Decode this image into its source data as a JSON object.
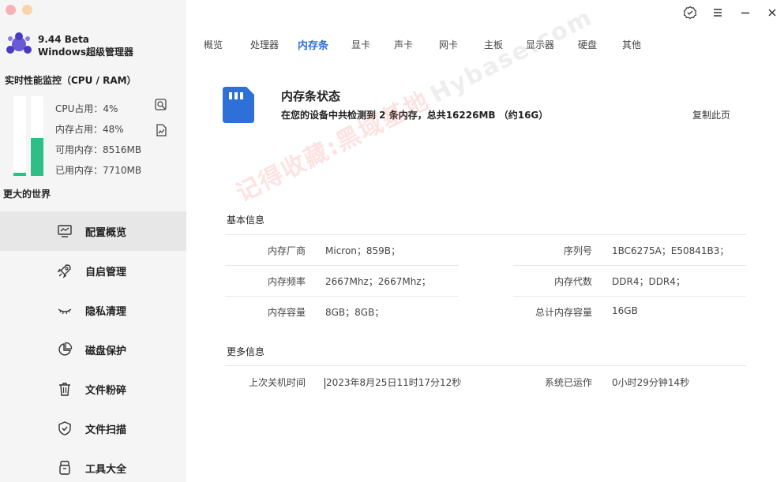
{
  "brand": {
    "version": "9.44 Beta",
    "name": "Windows超级管理器"
  },
  "monitor": {
    "title": "实时性能监控（CPU / RAM）",
    "cpu_percent": 4,
    "mem_percent": 48,
    "stats": [
      "CPU占用：4%",
      "内存占用：48%",
      "可用内存：8516MB",
      "已用内存：7710MB"
    ],
    "world_text": "更大的世界",
    "bar_color": "#2fbf86"
  },
  "nav": [
    {
      "label": "配置概览",
      "icon": "monitor-chart-icon",
      "active": true
    },
    {
      "label": "自启管理",
      "icon": "rocket-icon",
      "active": false
    },
    {
      "label": "隐私清理",
      "icon": "eye-closed-icon",
      "active": false
    },
    {
      "label": "磁盘保护",
      "icon": "pie-chart-icon",
      "active": false
    },
    {
      "label": "文件粉碎",
      "icon": "trash-icon",
      "active": false
    },
    {
      "label": "文件扫描",
      "icon": "shield-check-icon",
      "active": false
    },
    {
      "label": "工具大全",
      "icon": "toolbox-icon",
      "active": false
    }
  ],
  "tabs": [
    "概览",
    "处理器",
    "内存条",
    "显卡",
    "声卡",
    "网卡",
    "主板",
    "显示器",
    "硬盘",
    "其他"
  ],
  "active_tab": "内存条",
  "status": {
    "title": "内存条状态",
    "subtitle": "在您的设备中共检测到 2 条内存，总共16226MB （约16G）",
    "copy_label": "复制此页"
  },
  "watermark": {
    "main": "记得收藏:黑域基地",
    "domain": "Hybase.com"
  },
  "basic": {
    "title": "基本信息",
    "fields": {
      "vendor_label": "内存厂商",
      "vendor_value": "Micron；859B；",
      "serial_label": "序列号",
      "serial_value": "1BC6275A；E50841B3；",
      "freq_label": "内存频率",
      "freq_value": "2667Mhz；2667Mhz；",
      "gen_label": "内存代数",
      "gen_value": "DDR4；DDR4；",
      "cap_label": "内存容量",
      "cap_value": "8GB；8GB；",
      "total_label": "总计内存容量",
      "total_value": "16GB"
    }
  },
  "more": {
    "title": "更多信息",
    "fields": {
      "shutdown_label": "上次关机时间",
      "shutdown_value": "2023年8月25日11时17分12秒",
      "uptime_label": "系统已运作",
      "uptime_value": "0小时29分钟14秒"
    }
  },
  "colors": {
    "accent": "#2f6fd8",
    "green": "#2fbf86",
    "sidebar_bg": "#f5f5f5"
  }
}
